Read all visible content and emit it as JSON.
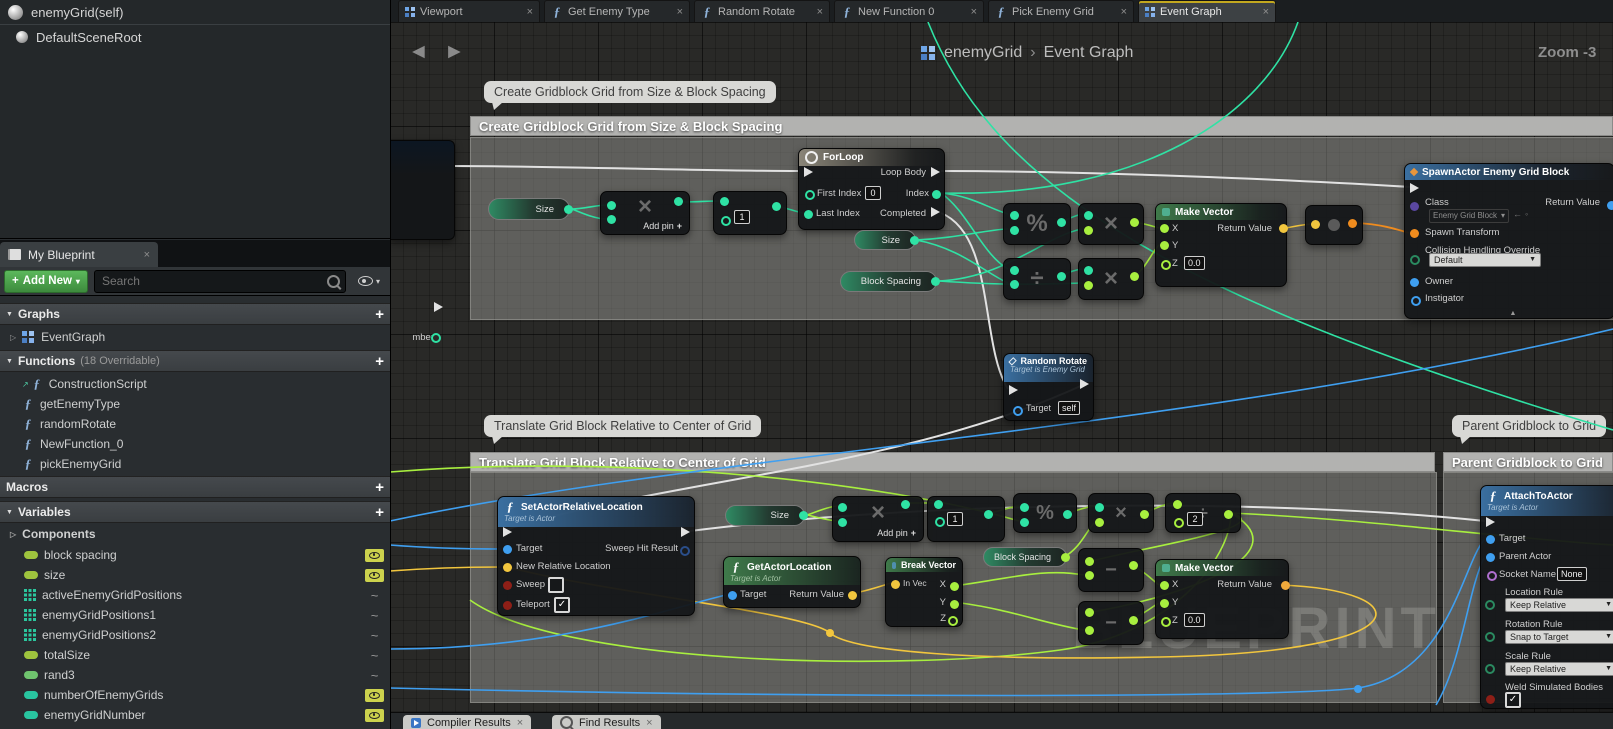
{
  "window": {
    "zoom_label": "Zoom -3",
    "watermark": "BLUEPRINT"
  },
  "palette": {
    "exec": "#e2e2e2",
    "int": "#2fe2a4",
    "float": "#a8ef3f",
    "vector": "#f2c63e",
    "transform": "#f08c1e",
    "object": "#3f9ff0",
    "bool": "#8e1f17",
    "enum": "#2a8a60",
    "name": "#b06fd0",
    "class": "#5a47a0",
    "accent_green": "#4caf50",
    "tab_highlight": "#c3a81f"
  },
  "icons": {
    "close": "×",
    "plus": "+",
    "dropdown_arrow": "▾",
    "select_arrow": "▼",
    "section_arrow": "▼",
    "collapsed_arrow": "▷",
    "back_arrow": "◄",
    "forward_arrow": "►",
    "function_glyph": "ƒ",
    "check": "✓",
    "closed_eye": "~",
    "multiply": "×",
    "divide": "÷",
    "percent": "%",
    "minus": "−",
    "breadcrumb_sep": "›",
    "back_small": "←",
    "circle_small": "◦",
    "expand_arrow": "▲",
    "construction_arrow": "↗"
  },
  "components_panel": {
    "root": "enemyGrid(self)",
    "child": "DefaultSceneRoot"
  },
  "my_blueprint": {
    "tab_label": "My Blueprint",
    "add_new_label": "Add New",
    "search_placeholder": "Search",
    "graphs_label": "Graphs",
    "event_graph_label": "EventGraph",
    "functions_label": "Functions",
    "functions_meta": "(18 Overridable)",
    "functions": [
      "ConstructionScript",
      "getEnemyType",
      "randomRotate",
      "NewFunction_0",
      "pickEnemyGrid"
    ],
    "macros_label": "Macros",
    "variables_label": "Variables",
    "components_label": "Components",
    "variables": [
      {
        "name": "block spacing",
        "kind": "float",
        "visible": true
      },
      {
        "name": "size",
        "kind": "float",
        "visible": true
      },
      {
        "name": "activeEnemyGridPositions",
        "kind": "vector-array",
        "visible": false
      },
      {
        "name": "enemyGridPositions1",
        "kind": "vector-array",
        "visible": false
      },
      {
        "name": "enemyGridPositions2",
        "kind": "vector-array",
        "visible": false
      },
      {
        "name": "totalSize",
        "kind": "float",
        "visible": false
      },
      {
        "name": "rand3",
        "kind": "float",
        "visible": false
      },
      {
        "name": "numberOfEnemyGrids",
        "kind": "int",
        "visible": true
      },
      {
        "name": "enemyGridNumber",
        "kind": "int",
        "visible": true
      }
    ]
  },
  "tabs": [
    {
      "label": "Viewport",
      "icon": "viewport-grid"
    },
    {
      "label": "Get Enemy Type",
      "icon": "function"
    },
    {
      "label": "Random Rotate",
      "icon": "function"
    },
    {
      "label": "New Function 0",
      "icon": "function"
    },
    {
      "label": "Pick Enemy Grid",
      "icon": "function"
    },
    {
      "label": "Event Graph",
      "icon": "graph-grid",
      "active": true
    }
  ],
  "breadcrumb": {
    "root": "enemyGrid",
    "current": "Event Graph"
  },
  "comments": {
    "create_grid": "Create Gridblock Grid from Size & Block Spacing",
    "translate": "Translate Grid Block Relative to Center of Grid",
    "parent": "Parent Gridblock to Grid"
  },
  "nodes": {
    "left_partial": {
      "pin_label": "mber"
    },
    "size_getter": {
      "label": "Size"
    },
    "block_spacing_getter": {
      "label": "Block Spacing"
    },
    "multiply_node": {
      "add_pin_label": "Add pin"
    },
    "int_one": "1",
    "int_two": "2",
    "forloop": {
      "title": "ForLoop",
      "first_index": "First Index",
      "first_index_value": "0",
      "last_index": "Last Index",
      "loop_body": "Loop Body",
      "index": "Index",
      "completed": "Completed"
    },
    "make_vector": {
      "title": "Make Vector",
      "x": "X",
      "y": "Y",
      "z": "Z",
      "z_value": "0.0",
      "return_value": "Return Value"
    },
    "spawn_actor": {
      "title": "SpawnActor Enemy Grid Block",
      "class_label": "Class",
      "class_value": "Enemy Grid Block",
      "spawn_transform": "Spawn Transform",
      "collision_label": "Collision Handling Override",
      "collision_value": "Default",
      "owner": "Owner",
      "instigator": "Instigator",
      "return_value": "Return Value"
    },
    "random_rotate": {
      "title": "Random Rotate",
      "subtitle": "Target is Enemy Grid",
      "target": "Target",
      "target_value": "self"
    },
    "set_actor_relative_location": {
      "title": "SetActorRelativeLocation",
      "subtitle": "Target is Actor",
      "target": "Target",
      "new_relative_location": "New Relative Location",
      "sweep": "Sweep",
      "teleport": "Teleport",
      "sweep_hit_result": "Sweep Hit Result"
    },
    "get_actor_location": {
      "title": "GetActorLocation",
      "subtitle": "Target is Actor",
      "target": "Target",
      "return_value": "Return Value"
    },
    "break_vector": {
      "title": "Break Vector",
      "in_vec": "In Vec",
      "x": "X",
      "y": "Y",
      "z": "Z"
    },
    "attach_to_actor": {
      "title": "AttachToActor",
      "subtitle": "Target is Actor",
      "target": "Target",
      "parent_actor": "Parent Actor",
      "socket_name": "Socket Name",
      "socket_value": "None",
      "location_rule": "Location Rule",
      "location_value": "Keep Relative",
      "rotation_rule": "Rotation Rule",
      "rotation_value": "Snap to Target",
      "scale_rule": "Scale Rule",
      "scale_value": "Keep Relative",
      "weld_label": "Weld Simulated Bodies"
    }
  },
  "bottom_tabs": {
    "compiler": "Compiler Results",
    "find": "Find Results"
  }
}
